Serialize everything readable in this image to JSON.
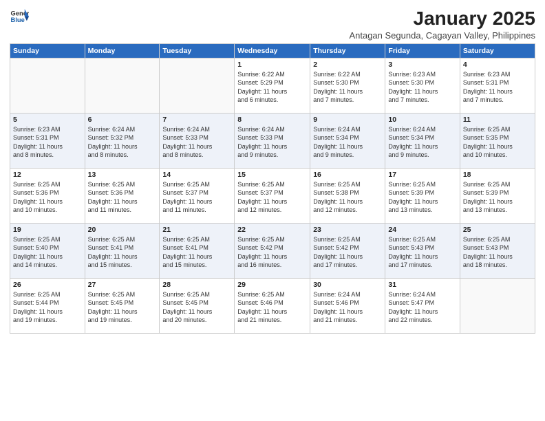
{
  "header": {
    "logo_line1": "General",
    "logo_line2": "Blue",
    "month_year": "January 2025",
    "location": "Antagan Segunda, Cagayan Valley, Philippines"
  },
  "days_of_week": [
    "Sunday",
    "Monday",
    "Tuesday",
    "Wednesday",
    "Thursday",
    "Friday",
    "Saturday"
  ],
  "weeks": [
    [
      {
        "num": "",
        "info": ""
      },
      {
        "num": "",
        "info": ""
      },
      {
        "num": "",
        "info": ""
      },
      {
        "num": "1",
        "info": "Sunrise: 6:22 AM\nSunset: 5:29 PM\nDaylight: 11 hours\nand 6 minutes."
      },
      {
        "num": "2",
        "info": "Sunrise: 6:22 AM\nSunset: 5:30 PM\nDaylight: 11 hours\nand 7 minutes."
      },
      {
        "num": "3",
        "info": "Sunrise: 6:23 AM\nSunset: 5:30 PM\nDaylight: 11 hours\nand 7 minutes."
      },
      {
        "num": "4",
        "info": "Sunrise: 6:23 AM\nSunset: 5:31 PM\nDaylight: 11 hours\nand 7 minutes."
      }
    ],
    [
      {
        "num": "5",
        "info": "Sunrise: 6:23 AM\nSunset: 5:31 PM\nDaylight: 11 hours\nand 8 minutes."
      },
      {
        "num": "6",
        "info": "Sunrise: 6:24 AM\nSunset: 5:32 PM\nDaylight: 11 hours\nand 8 minutes."
      },
      {
        "num": "7",
        "info": "Sunrise: 6:24 AM\nSunset: 5:33 PM\nDaylight: 11 hours\nand 8 minutes."
      },
      {
        "num": "8",
        "info": "Sunrise: 6:24 AM\nSunset: 5:33 PM\nDaylight: 11 hours\nand 9 minutes."
      },
      {
        "num": "9",
        "info": "Sunrise: 6:24 AM\nSunset: 5:34 PM\nDaylight: 11 hours\nand 9 minutes."
      },
      {
        "num": "10",
        "info": "Sunrise: 6:24 AM\nSunset: 5:34 PM\nDaylight: 11 hours\nand 9 minutes."
      },
      {
        "num": "11",
        "info": "Sunrise: 6:25 AM\nSunset: 5:35 PM\nDaylight: 11 hours\nand 10 minutes."
      }
    ],
    [
      {
        "num": "12",
        "info": "Sunrise: 6:25 AM\nSunset: 5:36 PM\nDaylight: 11 hours\nand 10 minutes."
      },
      {
        "num": "13",
        "info": "Sunrise: 6:25 AM\nSunset: 5:36 PM\nDaylight: 11 hours\nand 11 minutes."
      },
      {
        "num": "14",
        "info": "Sunrise: 6:25 AM\nSunset: 5:37 PM\nDaylight: 11 hours\nand 11 minutes."
      },
      {
        "num": "15",
        "info": "Sunrise: 6:25 AM\nSunset: 5:37 PM\nDaylight: 11 hours\nand 12 minutes."
      },
      {
        "num": "16",
        "info": "Sunrise: 6:25 AM\nSunset: 5:38 PM\nDaylight: 11 hours\nand 12 minutes."
      },
      {
        "num": "17",
        "info": "Sunrise: 6:25 AM\nSunset: 5:39 PM\nDaylight: 11 hours\nand 13 minutes."
      },
      {
        "num": "18",
        "info": "Sunrise: 6:25 AM\nSunset: 5:39 PM\nDaylight: 11 hours\nand 13 minutes."
      }
    ],
    [
      {
        "num": "19",
        "info": "Sunrise: 6:25 AM\nSunset: 5:40 PM\nDaylight: 11 hours\nand 14 minutes."
      },
      {
        "num": "20",
        "info": "Sunrise: 6:25 AM\nSunset: 5:41 PM\nDaylight: 11 hours\nand 15 minutes."
      },
      {
        "num": "21",
        "info": "Sunrise: 6:25 AM\nSunset: 5:41 PM\nDaylight: 11 hours\nand 15 minutes."
      },
      {
        "num": "22",
        "info": "Sunrise: 6:25 AM\nSunset: 5:42 PM\nDaylight: 11 hours\nand 16 minutes."
      },
      {
        "num": "23",
        "info": "Sunrise: 6:25 AM\nSunset: 5:42 PM\nDaylight: 11 hours\nand 17 minutes."
      },
      {
        "num": "24",
        "info": "Sunrise: 6:25 AM\nSunset: 5:43 PM\nDaylight: 11 hours\nand 17 minutes."
      },
      {
        "num": "25",
        "info": "Sunrise: 6:25 AM\nSunset: 5:43 PM\nDaylight: 11 hours\nand 18 minutes."
      }
    ],
    [
      {
        "num": "26",
        "info": "Sunrise: 6:25 AM\nSunset: 5:44 PM\nDaylight: 11 hours\nand 19 minutes."
      },
      {
        "num": "27",
        "info": "Sunrise: 6:25 AM\nSunset: 5:45 PM\nDaylight: 11 hours\nand 19 minutes."
      },
      {
        "num": "28",
        "info": "Sunrise: 6:25 AM\nSunset: 5:45 PM\nDaylight: 11 hours\nand 20 minutes."
      },
      {
        "num": "29",
        "info": "Sunrise: 6:25 AM\nSunset: 5:46 PM\nDaylight: 11 hours\nand 21 minutes."
      },
      {
        "num": "30",
        "info": "Sunrise: 6:24 AM\nSunset: 5:46 PM\nDaylight: 11 hours\nand 21 minutes."
      },
      {
        "num": "31",
        "info": "Sunrise: 6:24 AM\nSunset: 5:47 PM\nDaylight: 11 hours\nand 22 minutes."
      },
      {
        "num": "",
        "info": ""
      }
    ]
  ]
}
